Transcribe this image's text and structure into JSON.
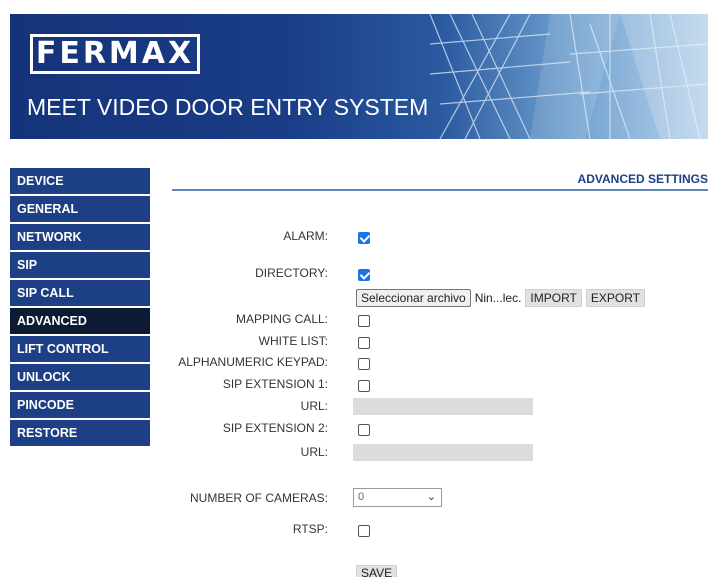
{
  "header": {
    "logo": "FERMAX",
    "title": "MEET VIDEO DOOR ENTRY SYSTEM"
  },
  "sidebar": {
    "items": [
      {
        "label": "DEVICE"
      },
      {
        "label": "GENERAL"
      },
      {
        "label": "NETWORK"
      },
      {
        "label": "SIP"
      },
      {
        "label": "SIP CALL"
      },
      {
        "label": "ADVANCED"
      },
      {
        "label": "LIFT CONTROL"
      },
      {
        "label": "UNLOCK"
      },
      {
        "label": "PINCODE"
      },
      {
        "label": "RESTORE"
      }
    ],
    "active": "ADVANCED"
  },
  "main": {
    "title": "ADVANCED SETTINGS",
    "alarm": {
      "label": "ALARM:",
      "checked": true
    },
    "directory": {
      "label": "DIRECTORY:",
      "checked": true
    },
    "file": {
      "choose_label": "Seleccionar archivo",
      "file_name": "Nin...lec.",
      "import_label": "IMPORT",
      "export_label": "EXPORT"
    },
    "mapping_call": {
      "label": "MAPPING CALL:",
      "checked": false
    },
    "white_list": {
      "label": "WHITE LIST:",
      "checked": false
    },
    "alphanumeric_keypad": {
      "label": "ALPHANUMERIC KEYPAD:",
      "checked": false
    },
    "sip_extension_1": {
      "label": "SIP EXTENSION 1:",
      "checked": false
    },
    "url_1": {
      "label": "URL:",
      "value": ""
    },
    "sip_extension_2": {
      "label": "SIP EXTENSION 2:",
      "checked": false
    },
    "url_2": {
      "label": "URL:",
      "value": ""
    },
    "number_of_cameras": {
      "label": "NUMBER OF CAMERAS:",
      "value": "0"
    },
    "rtsp": {
      "label": "RTSP:",
      "checked": false
    },
    "save_label": "SAVE"
  },
  "colors": {
    "nav_bg": "#1d3f86",
    "nav_active_bg": "#0c1a33",
    "checkbox_checked": "#1a73e8",
    "title_color": "#1d3f86"
  }
}
